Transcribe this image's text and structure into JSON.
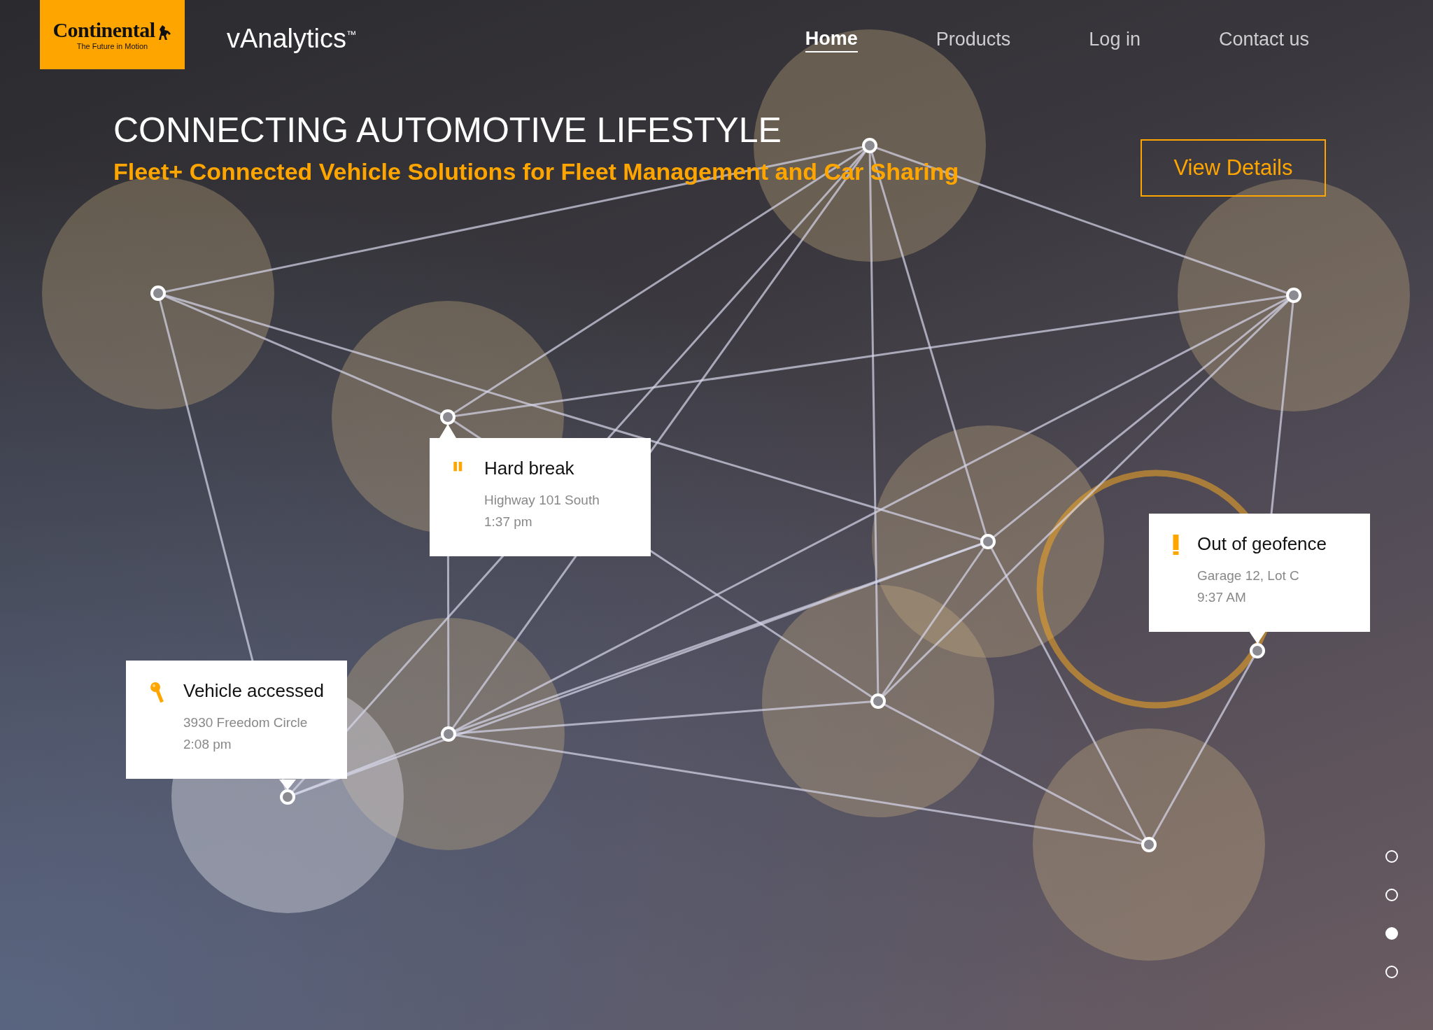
{
  "header": {
    "logo": {
      "brand": "Continental",
      "tagline": "The Future in Motion"
    },
    "product": "vAnalytics$^{™}$",
    "nav": [
      {
        "label": "Home",
        "selected": true
      },
      {
        "label": "Products",
        "selected": false
      },
      {
        "label": "Log in",
        "selected": false
      },
      {
        "label": "Contact us",
        "selected": false
      }
    ]
  },
  "hero": {
    "title": "CONNECTING AUTOMOTIVE LIFESTYLE",
    "subtitle": "Fleet+ Connected Vehicle Solutions for Fleet Management and Car Sharing",
    "button": "View Details"
  },
  "events": [
    {
      "kind": "brake",
      "title": "Hard break",
      "location": "Highway 101 South",
      "time": "1:37 pm"
    },
    {
      "kind": "geofence",
      "title": "Out of geofence",
      "location": "Garage 12, Lot C",
      "time": "9:37 AM"
    },
    {
      "kind": "key",
      "title": "Vehicle accessed",
      "location": "3930 Freedom Circle",
      "time": "2:08 pm"
    }
  ],
  "pager": [
    {
      "selected": false
    },
    {
      "selected": false
    },
    {
      "selected": true
    },
    {
      "selected": false
    }
  ]
}
